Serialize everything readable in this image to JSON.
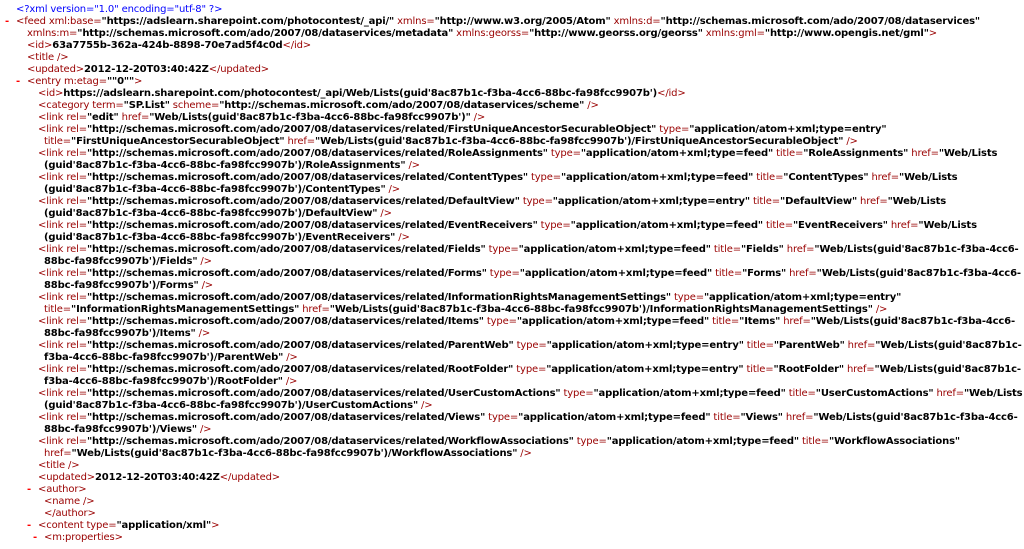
{
  "lines": [
    {
      "i": 0,
      "t": false,
      "segs": [
        [
          "pi",
          "<?xml version=\"1.0\" encoding=\"utf-8\" ?>"
        ]
      ]
    },
    {
      "i": 0,
      "t": true,
      "segs": [
        [
          "tag",
          "<feed "
        ],
        [
          "an",
          "xml:base="
        ],
        [
          "av",
          "\"https://adslearn.sharepoint.com/photocontest/_api/\""
        ],
        [
          "an",
          " xmlns="
        ],
        [
          "av",
          "\"http://www.w3.org/2005/Atom\""
        ],
        [
          "an",
          " xmlns:d="
        ],
        [
          "av",
          "\"http://schemas.microsoft.com/ado/2007/08/dataservices\""
        ]
      ]
    },
    {
      "i": 1,
      "t": false,
      "segs": [
        [
          "an",
          "xmlns:m="
        ],
        [
          "av",
          "\"http://schemas.microsoft.com/ado/2007/08/dataservices/metadata\""
        ],
        [
          "an",
          " xmlns:georss="
        ],
        [
          "av",
          "\"http://www.georss.org/georss\""
        ],
        [
          "an",
          " xmlns:gml="
        ],
        [
          "av",
          "\"http://www.opengis.net/gml\""
        ],
        [
          "tag",
          ">"
        ]
      ]
    },
    {
      "i": 1,
      "t": false,
      "segs": [
        [
          "tag",
          "<id>"
        ],
        [
          "tx",
          "63a7755b-362a-424b-8898-70e7ad5f4c0d"
        ],
        [
          "tag",
          "</id>"
        ]
      ]
    },
    {
      "i": 1,
      "t": false,
      "segs": [
        [
          "tag",
          "<title />"
        ]
      ]
    },
    {
      "i": 1,
      "t": false,
      "segs": [
        [
          "tag",
          "<updated>"
        ],
        [
          "tx",
          "2012-12-20T03:40:42Z"
        ],
        [
          "tag",
          "</updated>"
        ]
      ]
    },
    {
      "i": 1,
      "t": true,
      "segs": [
        [
          "tag",
          "<entry "
        ],
        [
          "an",
          "m:etag="
        ],
        [
          "av",
          "\"\"0\"\""
        ],
        [
          "tag",
          ">"
        ]
      ]
    },
    {
      "i": 2,
      "t": false,
      "segs": [
        [
          "tag",
          "<id>"
        ],
        [
          "tx",
          "https://adslearn.sharepoint.com/photocontest/_api/Web/Lists(guid'8ac87b1c-f3ba-4cc6-88bc-fa98fcc9907b')"
        ],
        [
          "tag",
          "</id>"
        ]
      ]
    },
    {
      "i": 2,
      "t": false,
      "segs": [
        [
          "tag",
          "<category "
        ],
        [
          "an",
          "term="
        ],
        [
          "av",
          "\"SP.List\""
        ],
        [
          "an",
          " scheme="
        ],
        [
          "av",
          "\"http://schemas.microsoft.com/ado/2007/08/dataservices/scheme\""
        ],
        [
          "tag",
          " />"
        ]
      ]
    },
    {
      "i": 2,
      "t": false,
      "segs": [
        [
          "tag",
          "<link "
        ],
        [
          "an",
          "rel="
        ],
        [
          "av",
          "\"edit\""
        ],
        [
          "an",
          " href="
        ],
        [
          "av",
          "\"Web/Lists(guid'8ac87b1c-f3ba-4cc6-88bc-fa98fcc9907b')\""
        ],
        [
          "tag",
          " />"
        ]
      ]
    },
    {
      "i": 2,
      "t": false,
      "segs": [
        [
          "tag",
          "<link "
        ],
        [
          "an",
          "rel="
        ],
        [
          "av",
          "\"http://schemas.microsoft.com/ado/2007/08/dataservices/related/FirstUniqueAncestorSecurableObject\""
        ],
        [
          "an",
          " type="
        ],
        [
          "av",
          "\"application/atom+xml;type=entry\""
        ]
      ]
    },
    {
      "i": 3,
      "t": false,
      "segs": [
        [
          "an",
          "title="
        ],
        [
          "av",
          "\"FirstUniqueAncestorSecurableObject\""
        ],
        [
          "an",
          " href="
        ],
        [
          "av",
          "\"Web/Lists(guid'8ac87b1c-f3ba-4cc6-88bc-fa98fcc9907b')/FirstUniqueAncestorSecurableObject\""
        ],
        [
          "tag",
          " />"
        ]
      ]
    },
    {
      "i": 2,
      "t": false,
      "segs": [
        [
          "tag",
          "<link "
        ],
        [
          "an",
          "rel="
        ],
        [
          "av",
          "\"http://schemas.microsoft.com/ado/2007/08/dataservices/related/RoleAssignments\""
        ],
        [
          "an",
          " type="
        ],
        [
          "av",
          "\"application/atom+xml;type=feed\""
        ],
        [
          "an",
          " title="
        ],
        [
          "av",
          "\"RoleAssignments\""
        ],
        [
          "an",
          " href="
        ],
        [
          "av",
          "\"Web/Lists"
        ]
      ]
    },
    {
      "i": 3,
      "t": false,
      "segs": [
        [
          "av",
          "(guid'8ac87b1c-f3ba-4cc6-88bc-fa98fcc9907b')/RoleAssignments\""
        ],
        [
          "tag",
          " />"
        ]
      ]
    },
    {
      "i": 2,
      "t": false,
      "segs": [
        [
          "tag",
          "<link "
        ],
        [
          "an",
          "rel="
        ],
        [
          "av",
          "\"http://schemas.microsoft.com/ado/2007/08/dataservices/related/ContentTypes\""
        ],
        [
          "an",
          " type="
        ],
        [
          "av",
          "\"application/atom+xml;type=feed\""
        ],
        [
          "an",
          " title="
        ],
        [
          "av",
          "\"ContentTypes\""
        ],
        [
          "an",
          " href="
        ],
        [
          "av",
          "\"Web/Lists"
        ]
      ]
    },
    {
      "i": 3,
      "t": false,
      "segs": [
        [
          "av",
          "(guid'8ac87b1c-f3ba-4cc6-88bc-fa98fcc9907b')/ContentTypes\""
        ],
        [
          "tag",
          " />"
        ]
      ]
    },
    {
      "i": 2,
      "t": false,
      "segs": [
        [
          "tag",
          "<link "
        ],
        [
          "an",
          "rel="
        ],
        [
          "av",
          "\"http://schemas.microsoft.com/ado/2007/08/dataservices/related/DefaultView\""
        ],
        [
          "an",
          " type="
        ],
        [
          "av",
          "\"application/atom+xml;type=entry\""
        ],
        [
          "an",
          " title="
        ],
        [
          "av",
          "\"DefaultView\""
        ],
        [
          "an",
          " href="
        ],
        [
          "av",
          "\"Web/Lists"
        ]
      ]
    },
    {
      "i": 3,
      "t": false,
      "segs": [
        [
          "av",
          "(guid'8ac87b1c-f3ba-4cc6-88bc-fa98fcc9907b')/DefaultView\""
        ],
        [
          "tag",
          " />"
        ]
      ]
    },
    {
      "i": 2,
      "t": false,
      "segs": [
        [
          "tag",
          "<link "
        ],
        [
          "an",
          "rel="
        ],
        [
          "av",
          "\"http://schemas.microsoft.com/ado/2007/08/dataservices/related/EventReceivers\""
        ],
        [
          "an",
          " type="
        ],
        [
          "av",
          "\"application/atom+xml;type=feed\""
        ],
        [
          "an",
          " title="
        ],
        [
          "av",
          "\"EventReceivers\""
        ],
        [
          "an",
          " href="
        ],
        [
          "av",
          "\"Web/Lists"
        ]
      ]
    },
    {
      "i": 3,
      "t": false,
      "segs": [
        [
          "av",
          "(guid'8ac87b1c-f3ba-4cc6-88bc-fa98fcc9907b')/EventReceivers\""
        ],
        [
          "tag",
          " />"
        ]
      ]
    },
    {
      "i": 2,
      "t": false,
      "segs": [
        [
          "tag",
          "<link "
        ],
        [
          "an",
          "rel="
        ],
        [
          "av",
          "\"http://schemas.microsoft.com/ado/2007/08/dataservices/related/Fields\""
        ],
        [
          "an",
          " type="
        ],
        [
          "av",
          "\"application/atom+xml;type=feed\""
        ],
        [
          "an",
          " title="
        ],
        [
          "av",
          "\"Fields\""
        ],
        [
          "an",
          " href="
        ],
        [
          "av",
          "\"Web/Lists(guid'8ac87b1c-f3ba-4cc6-"
        ]
      ]
    },
    {
      "i": 3,
      "t": false,
      "segs": [
        [
          "av",
          "88bc-fa98fcc9907b')/Fields\""
        ],
        [
          "tag",
          " />"
        ]
      ]
    },
    {
      "i": 2,
      "t": false,
      "segs": [
        [
          "tag",
          "<link "
        ],
        [
          "an",
          "rel="
        ],
        [
          "av",
          "\"http://schemas.microsoft.com/ado/2007/08/dataservices/related/Forms\""
        ],
        [
          "an",
          " type="
        ],
        [
          "av",
          "\"application/atom+xml;type=feed\""
        ],
        [
          "an",
          " title="
        ],
        [
          "av",
          "\"Forms\""
        ],
        [
          "an",
          " href="
        ],
        [
          "av",
          "\"Web/Lists(guid'8ac87b1c-f3ba-4cc6-"
        ]
      ]
    },
    {
      "i": 3,
      "t": false,
      "segs": [
        [
          "av",
          "88bc-fa98fcc9907b')/Forms\""
        ],
        [
          "tag",
          " />"
        ]
      ]
    },
    {
      "i": 2,
      "t": false,
      "segs": [
        [
          "tag",
          "<link "
        ],
        [
          "an",
          "rel="
        ],
        [
          "av",
          "\"http://schemas.microsoft.com/ado/2007/08/dataservices/related/InformationRightsManagementSettings\""
        ],
        [
          "an",
          " type="
        ],
        [
          "av",
          "\"application/atom+xml;type=entry\""
        ]
      ]
    },
    {
      "i": 3,
      "t": false,
      "segs": [
        [
          "an",
          "title="
        ],
        [
          "av",
          "\"InformationRightsManagementSettings\""
        ],
        [
          "an",
          " href="
        ],
        [
          "av",
          "\"Web/Lists(guid'8ac87b1c-f3ba-4cc6-88bc-fa98fcc9907b')/InformationRightsManagementSettings\""
        ],
        [
          "tag",
          " />"
        ]
      ]
    },
    {
      "i": 2,
      "t": false,
      "segs": [
        [
          "tag",
          "<link "
        ],
        [
          "an",
          "rel="
        ],
        [
          "av",
          "\"http://schemas.microsoft.com/ado/2007/08/dataservices/related/Items\""
        ],
        [
          "an",
          " type="
        ],
        [
          "av",
          "\"application/atom+xml;type=feed\""
        ],
        [
          "an",
          " title="
        ],
        [
          "av",
          "\"Items\""
        ],
        [
          "an",
          " href="
        ],
        [
          "av",
          "\"Web/Lists(guid'8ac87b1c-f3ba-4cc6-"
        ]
      ]
    },
    {
      "i": 3,
      "t": false,
      "segs": [
        [
          "av",
          "88bc-fa98fcc9907b')/Items\""
        ],
        [
          "tag",
          " />"
        ]
      ]
    },
    {
      "i": 2,
      "t": false,
      "segs": [
        [
          "tag",
          "<link "
        ],
        [
          "an",
          "rel="
        ],
        [
          "av",
          "\"http://schemas.microsoft.com/ado/2007/08/dataservices/related/ParentWeb\""
        ],
        [
          "an",
          " type="
        ],
        [
          "av",
          "\"application/atom+xml;type=entry\""
        ],
        [
          "an",
          " title="
        ],
        [
          "av",
          "\"ParentWeb\""
        ],
        [
          "an",
          " href="
        ],
        [
          "av",
          "\"Web/Lists(guid'8ac87b1c-"
        ]
      ]
    },
    {
      "i": 3,
      "t": false,
      "segs": [
        [
          "av",
          "f3ba-4cc6-88bc-fa98fcc9907b')/ParentWeb\""
        ],
        [
          "tag",
          " />"
        ]
      ]
    },
    {
      "i": 2,
      "t": false,
      "segs": [
        [
          "tag",
          "<link "
        ],
        [
          "an",
          "rel="
        ],
        [
          "av",
          "\"http://schemas.microsoft.com/ado/2007/08/dataservices/related/RootFolder\""
        ],
        [
          "an",
          " type="
        ],
        [
          "av",
          "\"application/atom+xml;type=entry\""
        ],
        [
          "an",
          " title="
        ],
        [
          "av",
          "\"RootFolder\""
        ],
        [
          "an",
          " href="
        ],
        [
          "av",
          "\"Web/Lists(guid'8ac87b1c-"
        ]
      ]
    },
    {
      "i": 3,
      "t": false,
      "segs": [
        [
          "av",
          "f3ba-4cc6-88bc-fa98fcc9907b')/RootFolder\""
        ],
        [
          "tag",
          " />"
        ]
      ]
    },
    {
      "i": 2,
      "t": false,
      "segs": [
        [
          "tag",
          "<link "
        ],
        [
          "an",
          "rel="
        ],
        [
          "av",
          "\"http://schemas.microsoft.com/ado/2007/08/dataservices/related/UserCustomActions\""
        ],
        [
          "an",
          " type="
        ],
        [
          "av",
          "\"application/atom+xml;type=feed\""
        ],
        [
          "an",
          " title="
        ],
        [
          "av",
          "\"UserCustomActions\""
        ],
        [
          "an",
          " href="
        ],
        [
          "av",
          "\"Web/Lists"
        ]
      ]
    },
    {
      "i": 3,
      "t": false,
      "segs": [
        [
          "av",
          "(guid'8ac87b1c-f3ba-4cc6-88bc-fa98fcc9907b')/UserCustomActions\""
        ],
        [
          "tag",
          " />"
        ]
      ]
    },
    {
      "i": 2,
      "t": false,
      "segs": [
        [
          "tag",
          "<link "
        ],
        [
          "an",
          "rel="
        ],
        [
          "av",
          "\"http://schemas.microsoft.com/ado/2007/08/dataservices/related/Views\""
        ],
        [
          "an",
          " type="
        ],
        [
          "av",
          "\"application/atom+xml;type=feed\""
        ],
        [
          "an",
          " title="
        ],
        [
          "av",
          "\"Views\""
        ],
        [
          "an",
          " href="
        ],
        [
          "av",
          "\"Web/Lists(guid'8ac87b1c-f3ba-4cc6-"
        ]
      ]
    },
    {
      "i": 3,
      "t": false,
      "segs": [
        [
          "av",
          "88bc-fa98fcc9907b')/Views\""
        ],
        [
          "tag",
          " />"
        ]
      ]
    },
    {
      "i": 2,
      "t": false,
      "segs": [
        [
          "tag",
          "<link "
        ],
        [
          "an",
          "rel="
        ],
        [
          "av",
          "\"http://schemas.microsoft.com/ado/2007/08/dataservices/related/WorkflowAssociations\""
        ],
        [
          "an",
          " type="
        ],
        [
          "av",
          "\"application/atom+xml;type=feed\""
        ],
        [
          "an",
          " title="
        ],
        [
          "av",
          "\"WorkflowAssociations\""
        ]
      ]
    },
    {
      "i": 3,
      "t": false,
      "segs": [
        [
          "an",
          "href="
        ],
        [
          "av",
          "\"Web/Lists(guid'8ac87b1c-f3ba-4cc6-88bc-fa98fcc9907b')/WorkflowAssociations\""
        ],
        [
          "tag",
          " />"
        ]
      ]
    },
    {
      "i": 2,
      "t": false,
      "segs": [
        [
          "tag",
          "<title />"
        ]
      ]
    },
    {
      "i": 2,
      "t": false,
      "segs": [
        [
          "tag",
          "<updated>"
        ],
        [
          "tx",
          "2012-12-20T03:40:42Z"
        ],
        [
          "tag",
          "</updated>"
        ]
      ]
    },
    {
      "i": 2,
      "t": true,
      "segs": [
        [
          "tag",
          "<author>"
        ]
      ]
    },
    {
      "i": 3,
      "t": false,
      "segs": [
        [
          "tag",
          "<name />"
        ]
      ]
    },
    {
      "i": 3,
      "t": false,
      "segs": [
        [
          "tag",
          "</author>"
        ]
      ]
    },
    {
      "i": 2,
      "t": true,
      "segs": [
        [
          "tag",
          "<content "
        ],
        [
          "an",
          "type="
        ],
        [
          "av",
          "\"application/xml\""
        ],
        [
          "tag",
          ">"
        ]
      ]
    },
    {
      "i": 3,
      "t": true,
      "segs": [
        [
          "tag",
          "<m:properties>"
        ]
      ]
    }
  ],
  "toggle_symbol": "-"
}
